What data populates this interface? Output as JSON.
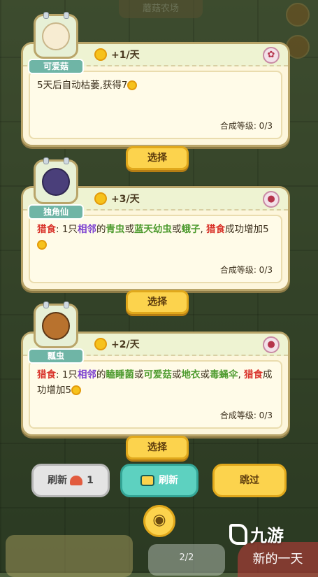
{
  "header": {
    "title": "蘑菇农场"
  },
  "cards": [
    {
      "name": "可爱菇",
      "rate": "+1/天",
      "badge_icon": "mushroom-icon",
      "description_parts": [
        {
          "text": "5天后自动枯萎,获得7",
          "style": "plain"
        }
      ],
      "level": "合成等级: 0/3",
      "select": "选择"
    },
    {
      "name": "独角仙",
      "rate": "+3/天",
      "badge_icon": "ladybug-icon",
      "description_parts": [
        {
          "text": "猎食",
          "style": "red"
        },
        {
          "text": ": 1只",
          "style": "plain"
        },
        {
          "text": "相邻",
          "style": "purple"
        },
        {
          "text": "的",
          "style": "plain"
        },
        {
          "text": "青虫",
          "style": "green"
        },
        {
          "text": "或",
          "style": "plain"
        },
        {
          "text": "蓝天幼虫",
          "style": "green"
        },
        {
          "text": "或",
          "style": "plain"
        },
        {
          "text": "蛾子",
          "style": "green"
        },
        {
          "text": ", ",
          "style": "plain"
        },
        {
          "text": "猎食",
          "style": "red"
        },
        {
          "text": "成功增加5",
          "style": "plain"
        }
      ],
      "level": "合成等级: 0/3",
      "select": "选择"
    },
    {
      "name": "瓢虫",
      "rate": "+2/天",
      "badge_icon": "ladybug-icon",
      "description_parts": [
        {
          "text": "猎食",
          "style": "red"
        },
        {
          "text": ": 1只",
          "style": "plain"
        },
        {
          "text": "相邻",
          "style": "purple"
        },
        {
          "text": "的",
          "style": "plain"
        },
        {
          "text": "瞌睡菌",
          "style": "green"
        },
        {
          "text": "或",
          "style": "plain"
        },
        {
          "text": "可爱菇",
          "style": "green"
        },
        {
          "text": "或",
          "style": "plain"
        },
        {
          "text": "地衣",
          "style": "green"
        },
        {
          "text": "或",
          "style": "plain"
        },
        {
          "text": "毒蝇伞",
          "style": "green"
        },
        {
          "text": ", ",
          "style": "plain"
        },
        {
          "text": "猎食",
          "style": "red"
        },
        {
          "text": "成功增加5",
          "style": "plain"
        }
      ],
      "level": "合成等级: 0/3",
      "select": "选择"
    }
  ],
  "bottom": {
    "refresh_label": "刷新",
    "refresh_cost": "1",
    "ad_refresh_label": "刷新",
    "skip_label": "跳过",
    "drop_counter": "2/2",
    "new_day": "新的一天",
    "watermark": "九游"
  }
}
